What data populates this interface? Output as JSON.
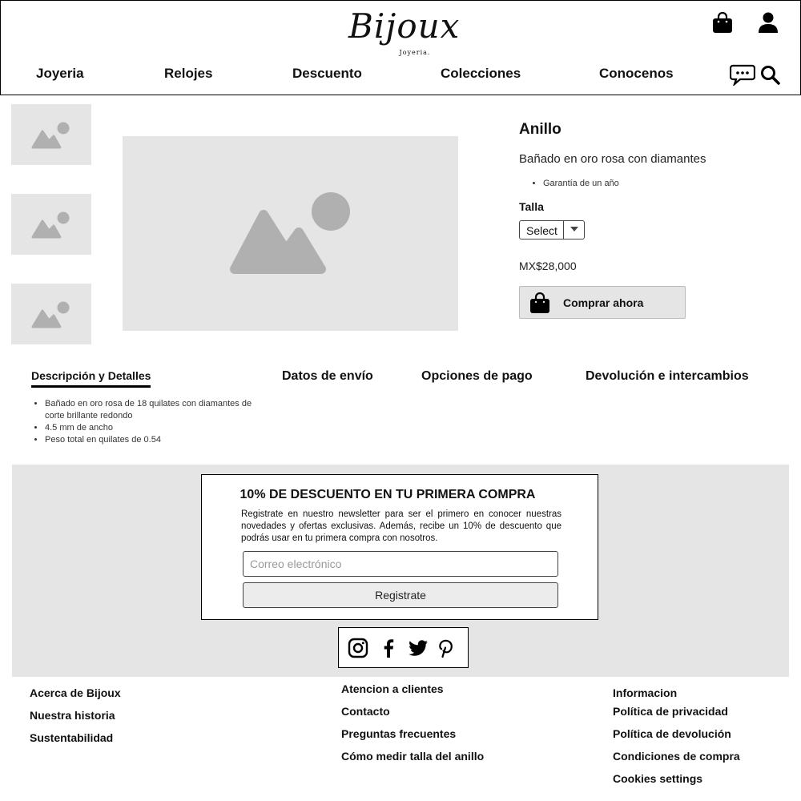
{
  "brand": {
    "logo_text": "Bijoux",
    "logo_sub": "Joyeria."
  },
  "header": {
    "icons": [
      "shopping-bag-icon",
      "user-icon",
      "chat-icon",
      "search-icon"
    ],
    "nav": [
      "Joyeria",
      "Relojes",
      "Descuento",
      "Colecciones",
      "Conocenos"
    ]
  },
  "product": {
    "thumbnails": [
      "image-placeholder-icon",
      "image-placeholder-icon",
      "image-placeholder-icon"
    ],
    "title": "Anillo",
    "subtitle": "Bañado en oro rosa con diamantes",
    "bullets": [
      "Garantía de un año"
    ],
    "size_label": "Talla",
    "size_select": "Select",
    "price": "MX$28,000",
    "buy_label": "Comprar ahora"
  },
  "tabs": {
    "items": [
      "Descripción y Detalles",
      "Datos de envío",
      "Opciones de pago",
      "Devolución e intercambios"
    ],
    "active": 0,
    "description": [
      "Bañado en oro rosa de 18 quilates con diamantes de corte brillante redondo",
      "4.5 mm de ancho",
      "Peso total en quilates de 0.54"
    ]
  },
  "newsletter": {
    "title": "10% DE DESCUENTO EN TU PRIMERA COMPRA",
    "text": "Registrate en nuestro newsletter para ser el primero en conocer nuestras novedades y ofertas exclusivas. Además, recibe un 10% de descuento que podrás usar en tu primera compra con nosotros.",
    "email_placeholder": "Correo electrónico",
    "button": "Registrate"
  },
  "social": [
    "instagram-icon",
    "facebook-icon",
    "twitter-icon",
    "pinterest-icon"
  ],
  "footer": {
    "col1": [
      "Acerca de Bijoux",
      "Nuestra historia",
      "Sustentabilidad"
    ],
    "col2": [
      "Atencion a clientes",
      "Contacto",
      "Preguntas frecuentes",
      "Cómo medir talla del anillo"
    ],
    "col3": [
      "Informacion",
      "Política de privacidad",
      "Política de devolución",
      "Condiciones de compra",
      "Cookies settings"
    ]
  },
  "colors": {
    "placeholder_bg": "#e5e5e5",
    "placeholder_icon": "#b0b0b0",
    "accent": "#111111"
  }
}
